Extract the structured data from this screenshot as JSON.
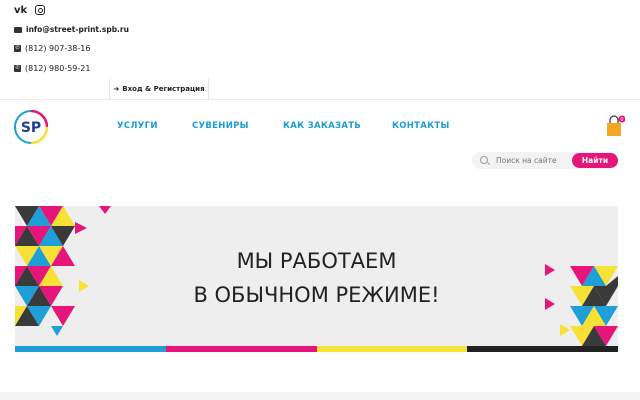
{
  "header": {
    "social": [
      "vk-icon",
      "instagram-icon"
    ],
    "social_vk": "vk",
    "email": "info@street-print.spb.ru",
    "phones": [
      "(812) 907-38-16",
      "(812) 980-59-21"
    ],
    "login_label": "Вход & Регистрация"
  },
  "logo": {
    "text": "SP"
  },
  "nav": {
    "items": [
      "УСЛУГИ",
      "СУВЕНИРЫ",
      "КАК ЗАКАЗАТЬ",
      "КОНТАКТЫ"
    ]
  },
  "cart": {
    "count": "0"
  },
  "search": {
    "placeholder": "Поиск на сайте",
    "button_label": "Найти"
  },
  "banner": {
    "line1": "МЫ РАБОТАЕМ",
    "line2": "В ОБЫЧНОМ РЕЖИМЕ!",
    "stripe_colors": [
      "#1f9fd8",
      "#e5157a",
      "#f7e135",
      "#222222"
    ]
  },
  "colors": {
    "accent": "#1b9bd7",
    "brand_pink": "#e5157a",
    "yellow": "#f7e135",
    "dark": "#3a3a3a"
  }
}
